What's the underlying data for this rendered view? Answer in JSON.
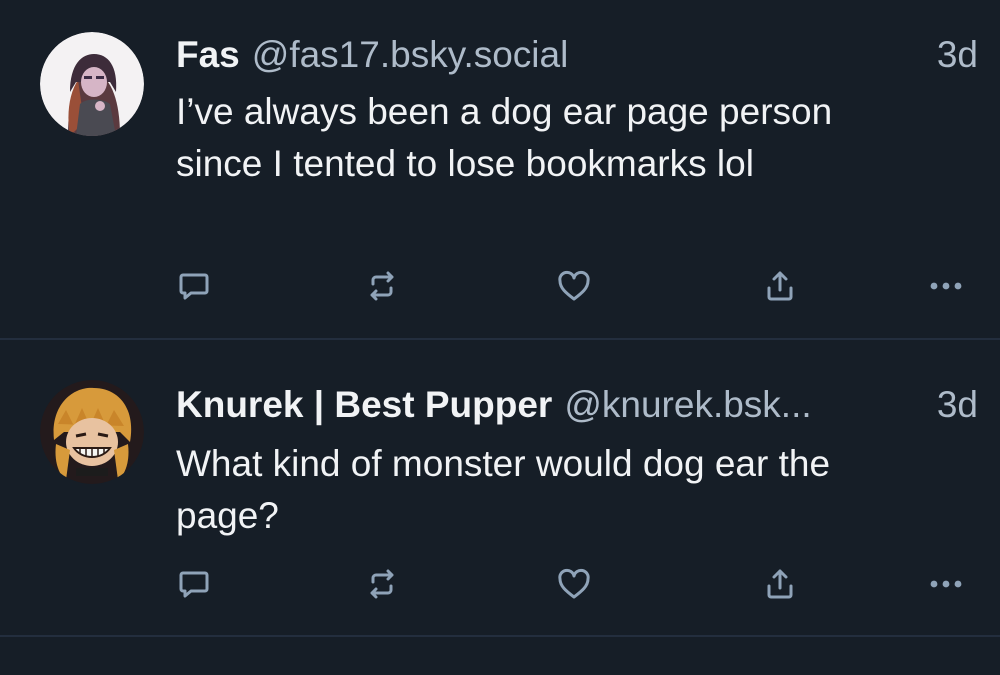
{
  "posts": [
    {
      "author_name": "Fas",
      "handle": "@fas17.bsky.social",
      "time": "3d",
      "text": "I’ve always been a dog ear page person since I tented to lose bookmarks lol",
      "avatar": "avatar-illustration-girl-hoodie"
    },
    {
      "author_name": "Knurek | Best Pupper",
      "handle": "@knurek.bsk...",
      "time": "3d",
      "text": "What kind of monster would dog ear the page?",
      "avatar": "avatar-illustration-grinning-blonde"
    }
  ],
  "actions": {
    "reply_icon": "speech-bubble-icon",
    "repost_icon": "repost-arrows-icon",
    "like_icon": "heart-outline-icon",
    "share_icon": "share-upload-icon",
    "more_icon": "ellipsis-icon"
  },
  "colors": {
    "background": "#161e27",
    "divider": "#232e3e",
    "text_primary": "#f1f3f5",
    "text_secondary": "#aebbc9",
    "icon": "#8fa3b8"
  }
}
